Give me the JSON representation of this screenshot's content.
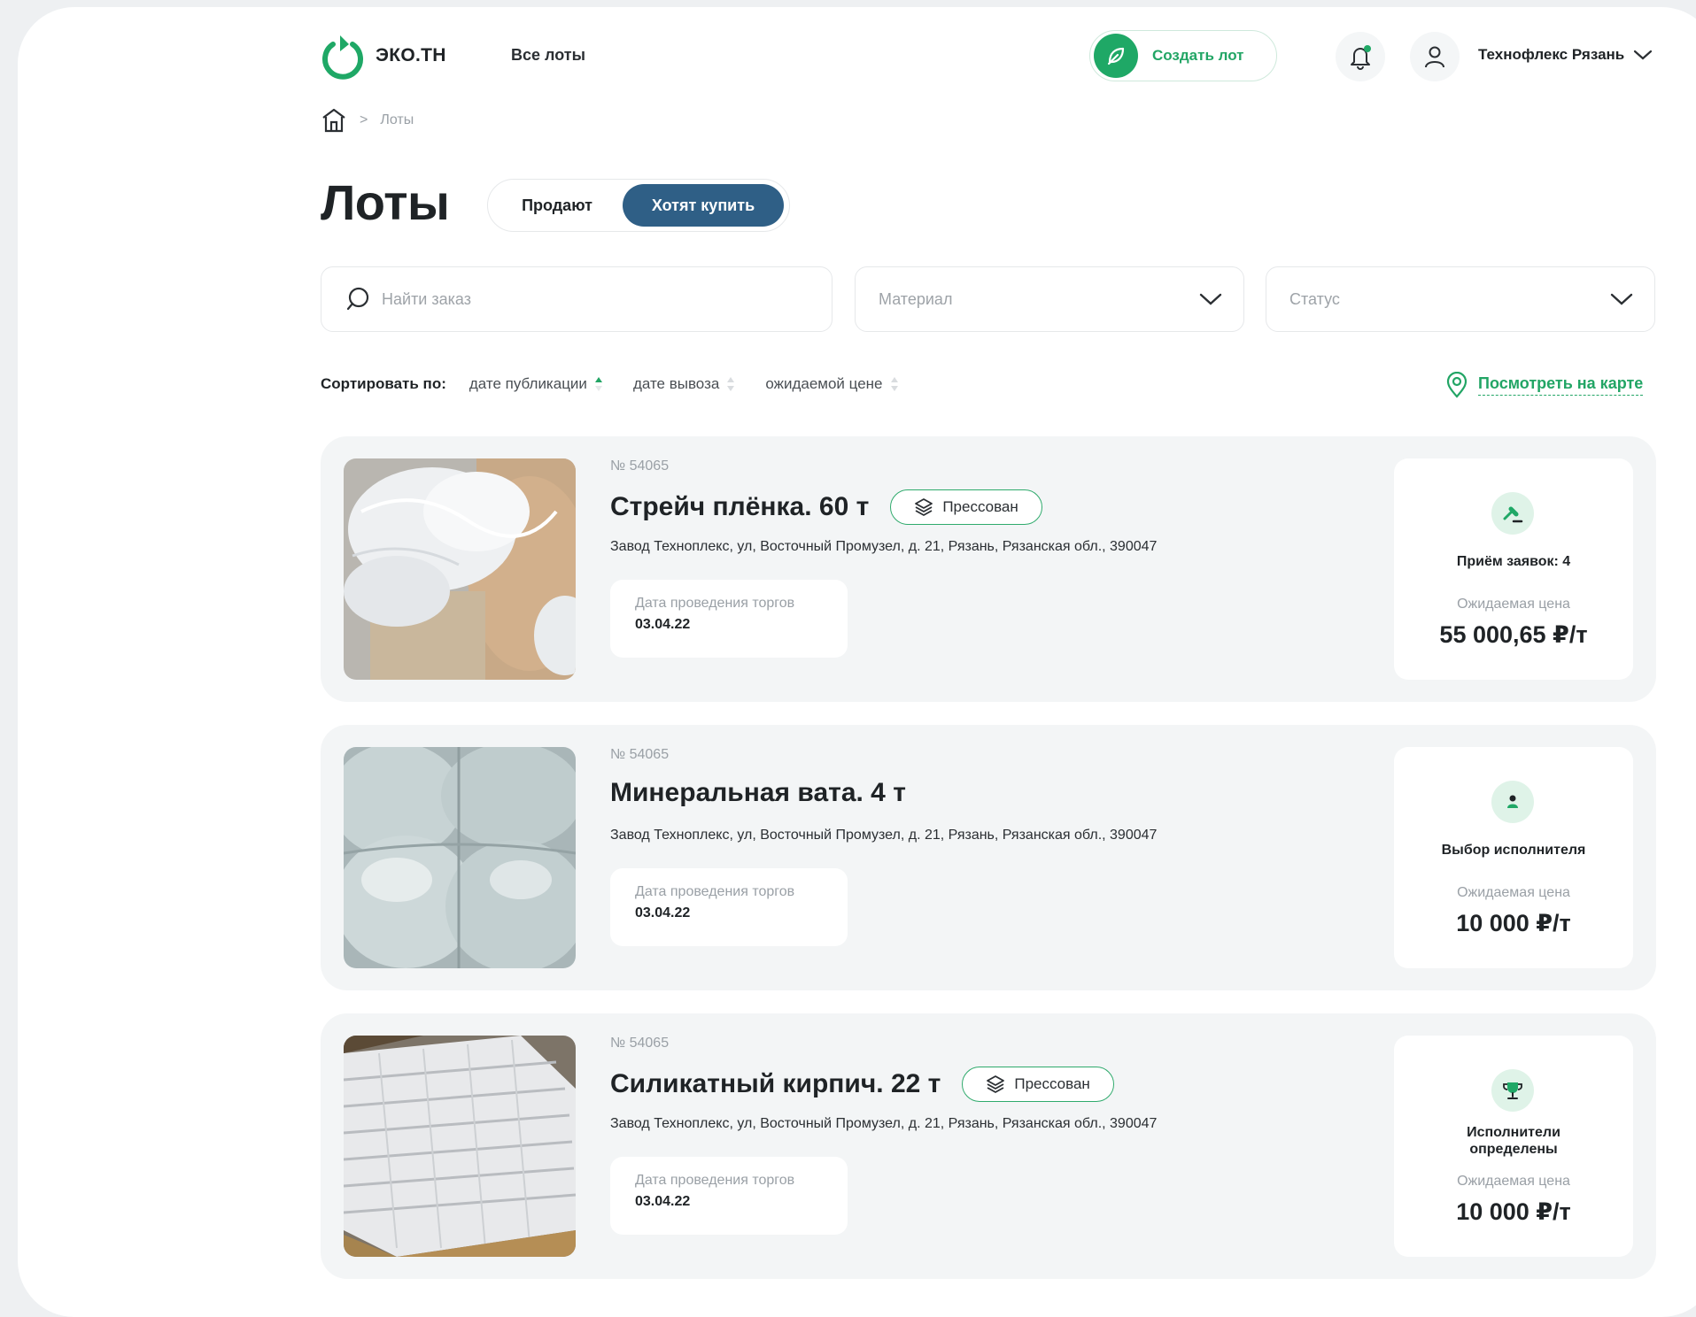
{
  "header": {
    "logo_text": "ЭКО.ТН",
    "nav_all": "Все лоты",
    "create_label": "Создать лот",
    "user_name": "Технофлекс Рязань"
  },
  "breadcrumb": {
    "sep": ">",
    "current": "Лоты"
  },
  "page": {
    "title": "Лоты",
    "toggle": {
      "sell": "Продают",
      "buy": "Хотят купить",
      "active": "buy"
    }
  },
  "filters": {
    "search_placeholder": "Найти заказ",
    "material_placeholder": "Материал",
    "status_placeholder": "Статус"
  },
  "sort": {
    "label": "Сортировать по:",
    "options": [
      "дате публикации",
      "дате вывоза",
      "ожидаемой цене"
    ],
    "active": 0
  },
  "map_link": "Посмотреть на карте",
  "colors": {
    "accent_green": "#22a565",
    "toggle_active": "#2f5f86",
    "card_bg": "#f3f5f6"
  },
  "lots": [
    {
      "number": "№ 54065",
      "title": "Стрейч плёнка. 60 т",
      "badge": "Прессован",
      "address": "Завод Техноплекс, ул, Восточный Промузел, д. 21, Рязань, Рязанская обл., 390047",
      "date_label": "Дата проведения торгов",
      "date_value": "03.04.22",
      "status_icon": "auction-hammer-icon",
      "status": "Приём заявок: 4",
      "price_label": "Ожидаемая цена",
      "price_value": "55 000,65 ₽/т"
    },
    {
      "number": "№ 54065",
      "title": "Минеральная вата. 4 т",
      "badge": "",
      "address": "Завод Техноплекс, ул, Восточный Промузел, д. 21, Рязань, Рязанская обл., 390047",
      "date_label": "Дата проведения торгов",
      "date_value": "03.04.22",
      "status_icon": "person-icon",
      "status": "Выбор исполнителя",
      "price_label": "Ожидаемая цена",
      "price_value": "10 000 ₽/т"
    },
    {
      "number": "№ 54065",
      "title": "Силикатный кирпич. 22 т",
      "badge": "Прессован",
      "address": "Завод Техноплекс, ул, Восточный Промузел, д. 21, Рязань, Рязанская обл., 390047",
      "date_label": "Дата проведения торгов",
      "date_value": "03.04.22",
      "status_icon": "trophy-icon",
      "status_line1": "Исполнители",
      "status_line2": "определены",
      "price_label": "Ожидаемая цена",
      "price_value": "10 000 ₽/т"
    }
  ]
}
